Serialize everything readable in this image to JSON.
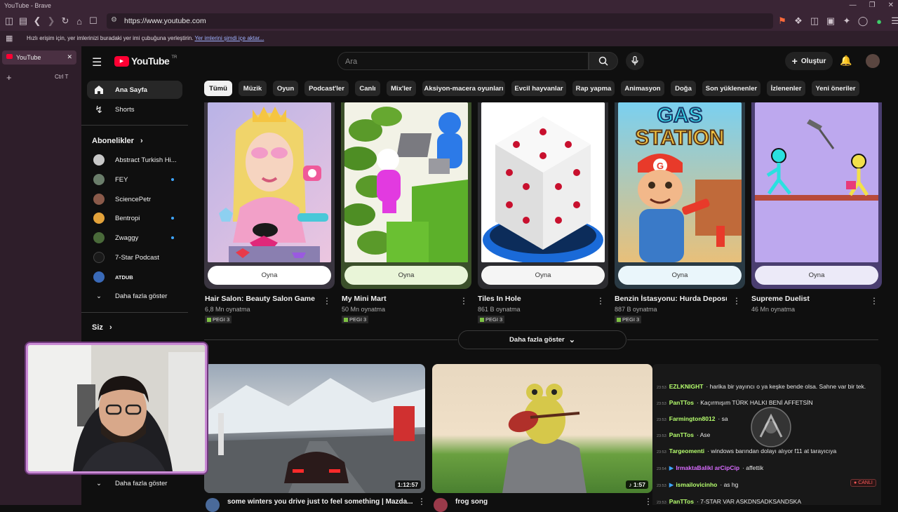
{
  "browser": {
    "window_title": "YouTube - Brave",
    "url": "https://www.youtube.com",
    "import_notice": "Hızlı erişim için, yer imlerinizi buradaki yer imi çubuğuna yerleştirin.",
    "import_link": "Yer imlerini şimdi içe aktar...",
    "tab_title": "YouTube",
    "new_tab_shortcut": "Ctrl  T"
  },
  "header": {
    "logo_text": "YouTube",
    "logo_region": "TR",
    "search_placeholder": "Ara",
    "create_label": "Oluştur"
  },
  "chips": [
    "Tümü",
    "Müzik",
    "Oyun",
    "Podcast'ler",
    "Canlı",
    "Mix'ler",
    "Aksiyon-macera oyunları",
    "Evcil hayvanlar",
    "Rap yapma",
    "Animasyon",
    "Doğa",
    "Son yüklenenler",
    "İzlenenler",
    "Yeni öneriler"
  ],
  "sidebar": {
    "home": "Ana Sayfa",
    "shorts": "Shorts",
    "subscriptions_title": "Abonelikler",
    "channels": [
      {
        "name": "Abstract Turkish Hi...",
        "color": "#c8c8c8",
        "dot": false
      },
      {
        "name": "FEY",
        "color": "#6a7d6a",
        "dot": true
      },
      {
        "name": "SciencePetr",
        "color": "#8a5a4a",
        "dot": false
      },
      {
        "name": "Bentropi",
        "color": "#e3a23a",
        "dot": true
      },
      {
        "name": "Zwaggy",
        "color": "#4a6a3a",
        "dot": true
      },
      {
        "name": "7-Star Podcast",
        "color": "#1a1a1a",
        "dot": false
      },
      {
        "name": "ATDUB",
        "color": "#3a6ab8",
        "dot": false
      }
    ],
    "show_more": "Daha fazla göster",
    "you_title": "Siz",
    "show_more_2": "Daha fazla göster"
  },
  "games": [
    {
      "title": "Hair Salon: Beauty Salon Game",
      "plays": "6,8 Mn oynatma",
      "rating": "PEGI 3",
      "play": "Oyna"
    },
    {
      "title": "My Mini Mart",
      "plays": "50 Mn oynatma",
      "rating": "PEGI 3",
      "play": "Oyna"
    },
    {
      "title": "Tiles In Hole",
      "plays": "861 B oynatma",
      "rating": "PEGI 3",
      "play": "Oyna"
    },
    {
      "title": "Benzin İstasyonu: Hurda Deposu...",
      "plays": "887 B oynatma",
      "rating": "PEGI 3",
      "play": "Oyna"
    },
    {
      "title": "Supreme Duelist",
      "plays": "46 Mn oynatma",
      "rating": "",
      "play": "Oyna"
    }
  ],
  "game_art_text": {
    "gas": "GAS",
    "station": "STATION",
    "g": "G"
  },
  "show_more_games": "Daha fazla göster",
  "videos": [
    {
      "title": "some winters you drive just to feel something | Mazda...",
      "duration": "1:12:57"
    },
    {
      "title": "frog song",
      "duration": "1:57"
    }
  ],
  "chat": {
    "messages": [
      {
        "time": "23:53",
        "user": "EZLKNIGHT",
        "color": "#b6ff6e",
        "text": "harika bir yayıncı o ya keşke bende olsa. Sahne var bir tek."
      },
      {
        "time": "23:53",
        "user": "PanTTos",
        "color": "#b6ff6e",
        "text": "Kaçırmışım TÜRK HALKI BENİ AFFETSİN"
      },
      {
        "time": "23:53",
        "user": "Farmington8012",
        "color": "#b6ff6e",
        "text": "sa"
      },
      {
        "time": "23:53",
        "user": "PanTTos",
        "color": "#b6ff6e",
        "text": "Ase"
      },
      {
        "time": "23:53",
        "user": "Targeomenti",
        "color": "#b6ff6e",
        "text": "windows barından dolayı alıyor f11 at tarayıcıya"
      },
      {
        "time": "23:54",
        "user": "IrmaktaBalikl arCipCip",
        "color": "#d86bff",
        "text": "affettik"
      },
      {
        "time": "23:53",
        "user": "ismailovicinho",
        "color": "#b6ff6e",
        "text": "as hg"
      },
      {
        "time": "23:53",
        "user": "PanTTos",
        "color": "#b6ff6e",
        "text": "7-STAR VAR ASKDNSADKSANDSKA"
      }
    ],
    "live_badge": "CANLI"
  }
}
